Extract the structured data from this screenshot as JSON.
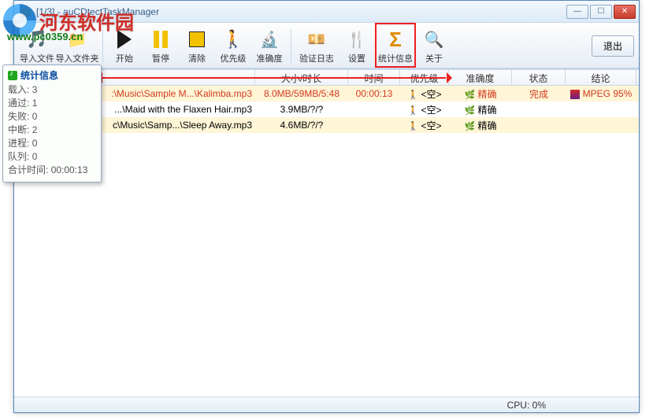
{
  "watermark": {
    "text": "河东软件园",
    "url": "www.pc0359.cn"
  },
  "window": {
    "title": "[1/3] - auCDtectTaskManager"
  },
  "win_buttons": {
    "min": "—",
    "max": "☐",
    "close": "✕"
  },
  "toolbar": {
    "import_files": "导入文件",
    "import_folder": "导入文件夹",
    "start": "开始",
    "pause": "暂停",
    "clear": "清除",
    "priority": "优先级",
    "accuracy": "准确度",
    "verify_log": "验证日志",
    "settings": "设置",
    "stats": "统计信息",
    "about": "关于",
    "quit": "退出"
  },
  "columns": {
    "size_dur": "大小/时长",
    "time": "时间",
    "priority": "优先级",
    "accuracy": "准确度",
    "status": "状态",
    "result": "结论"
  },
  "rows": [
    {
      "file": ":\\Music\\Sample M...\\Kalimba.mp3",
      "size": "8.0MB/59MB/5:48",
      "time": "00:00:13",
      "priority": "<空>",
      "accuracy": "精确",
      "status": "完成",
      "result": "MPEG 95%",
      "hl": true
    },
    {
      "file": "...\\Maid with the Flaxen Hair.mp3",
      "size": "3.9MB/?/?",
      "time": "",
      "priority": "<空>",
      "accuracy": "精确",
      "status": "",
      "result": "",
      "hl": false
    },
    {
      "file": "c\\Music\\Samp...\\Sleep Away.mp3",
      "size": "4.6MB/?/?",
      "time": "",
      "priority": "<空>",
      "accuracy": "精确",
      "status": "",
      "result": "",
      "hl": false
    }
  ],
  "popup": {
    "title": "统计信息",
    "loaded_l": "载入:",
    "loaded_v": "3",
    "passed_l": "通过:",
    "passed_v": "1",
    "failed_l": "失败:",
    "failed_v": "0",
    "aborted_l": "中断:",
    "aborted_v": "2",
    "progress_l": "进程:",
    "progress_v": "0",
    "queue_l": "队列:",
    "queue_v": "0",
    "total_l": "合计时间:",
    "total_v": "00:00:13"
  },
  "status": {
    "cpu": "CPU: 0%"
  },
  "icons": {
    "runner": "🚶",
    "leaf": "🌿"
  }
}
